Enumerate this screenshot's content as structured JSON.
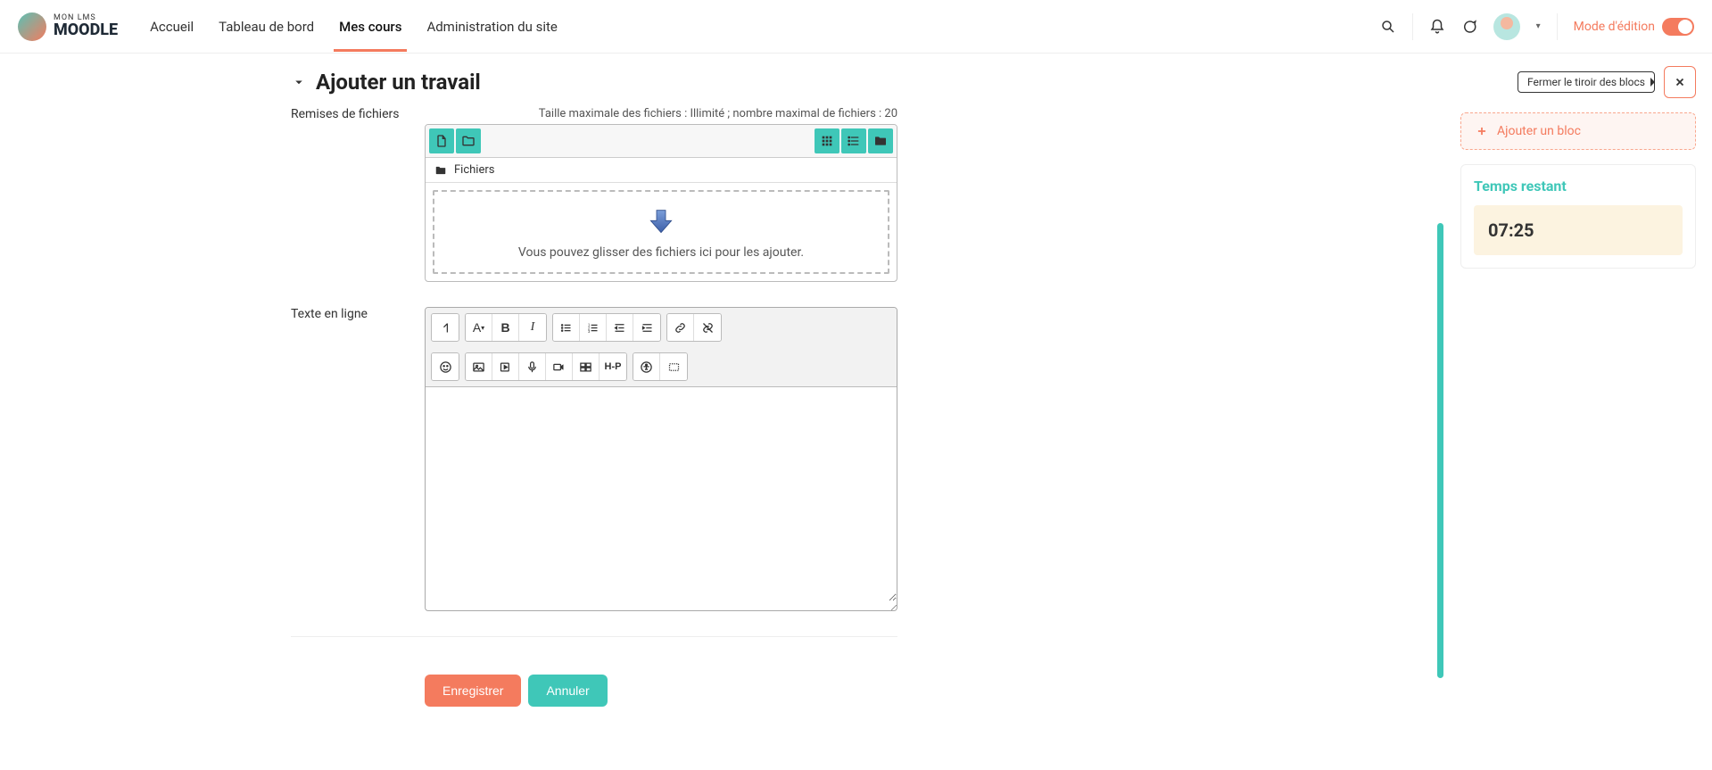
{
  "brand": {
    "small": "MON LMS",
    "big": "MOODLE"
  },
  "nav": {
    "home": "Accueil",
    "dashboard": "Tableau de bord",
    "mycourses": "Mes cours",
    "siteadmin": "Administration du site"
  },
  "edit_mode_label": "Mode d'édition",
  "section_title": "Ajouter un travail",
  "labels": {
    "file_submissions": "Remises de fichiers",
    "online_text": "Texte en ligne"
  },
  "file_hint": "Taille maximale des fichiers : Illimité ; nombre maximal de fichiers : 20",
  "file_path_label": "Fichiers",
  "dropzone_text": "Vous pouvez glisser des fichiers ici pour les ajouter.",
  "editor_h5p": "H-P",
  "editor_style_letter": "A",
  "editor_bold": "B",
  "editor_italic": "I",
  "actions": {
    "save": "Enregistrer",
    "cancel": "Annuler"
  },
  "drawer": {
    "tooltip": "Fermer le tiroir des blocs",
    "add_block": "Ajouter un bloc",
    "time_remaining_title": "Temps restant",
    "time_value": "07:25"
  }
}
